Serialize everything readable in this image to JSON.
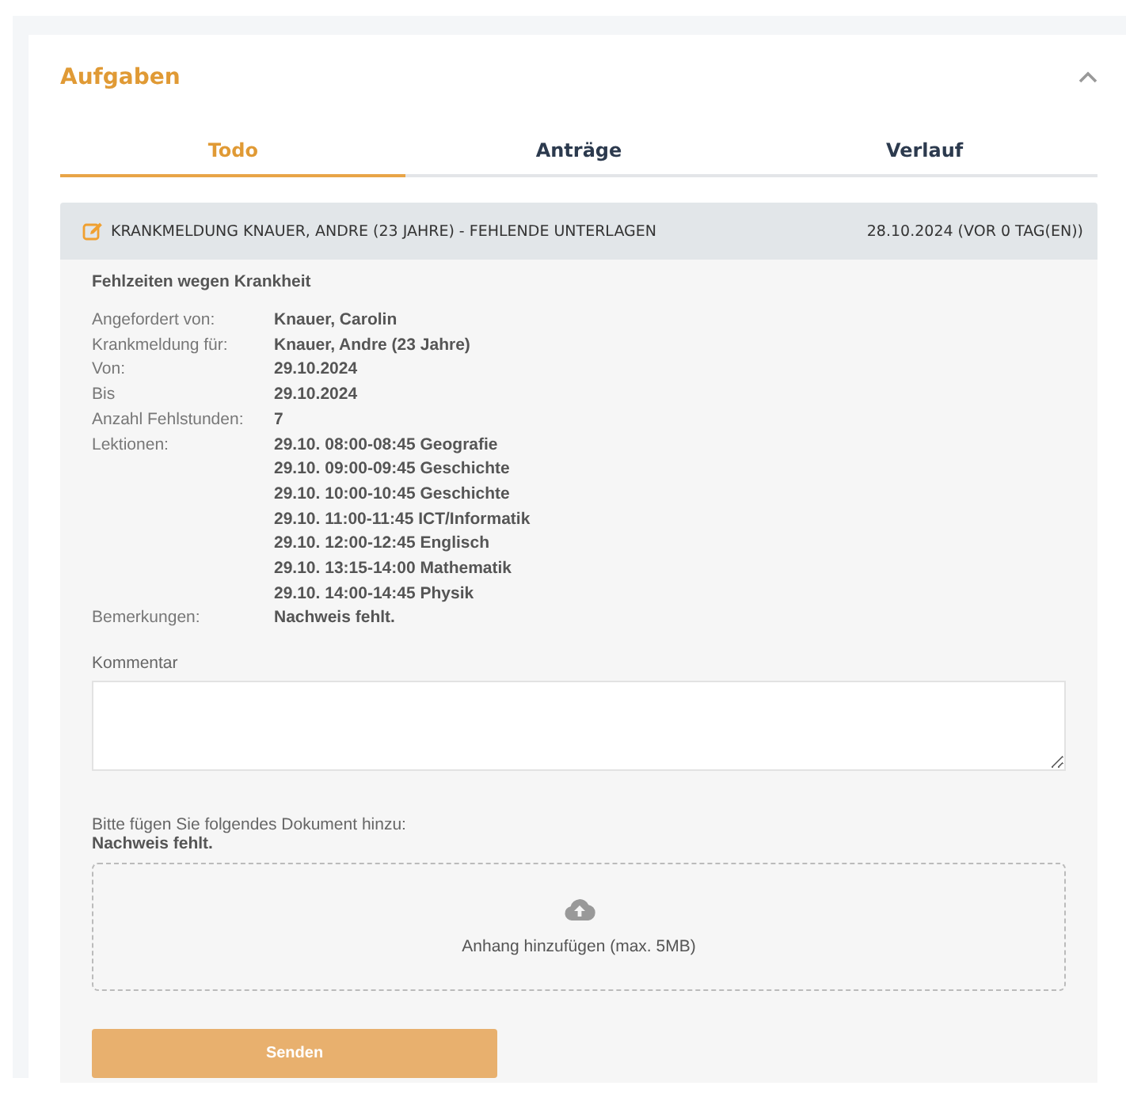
{
  "panel": {
    "title": "Aufgaben",
    "expanded": true
  },
  "tabs": [
    {
      "label": "Todo",
      "selected": true
    },
    {
      "label": "Anträge",
      "selected": false
    },
    {
      "label": "Verlauf",
      "selected": false
    }
  ],
  "task": {
    "title": "KRANKMELDUNG KNAUER, ANDRE (23 JAHRE) - FEHLENDE UNTERLAGEN",
    "date": "28.10.2024 (VOR 0 TAG(EN))",
    "section_title": "Fehlzeiten wegen Krankheit",
    "details": [
      {
        "label": "Angefordert von:",
        "values": [
          "Knauer, Carolin"
        ]
      },
      {
        "label": "Krankmeldung für:",
        "values": [
          "Knauer, Andre (23 Jahre)"
        ]
      },
      {
        "label": "Von:",
        "values": [
          "29.10.2024"
        ]
      },
      {
        "label": "Bis",
        "values": [
          "29.10.2024"
        ]
      },
      {
        "label": "Anzahl Fehlstunden:",
        "values": [
          "7"
        ]
      },
      {
        "label": "Lektionen:",
        "values": [
          "29.10. 08:00-08:45 Geografie",
          "29.10. 09:00-09:45 Geschichte",
          "29.10. 10:00-10:45 Geschichte",
          "29.10. 11:00-11:45 ICT/Informatik",
          "29.10. 12:00-12:45 Englisch",
          "29.10. 13:15-14:00 Mathematik",
          "29.10. 14:00-14:45 Physik"
        ]
      },
      {
        "label": "Bemerkungen:",
        "values": [
          "Nachweis fehlt."
        ]
      }
    ],
    "comment": {
      "label": "Kommentar"
    },
    "upload": {
      "instruction": "Bitte fügen Sie folgendes Dokument hinzu:",
      "document": "Nachweis fehlt.",
      "dropzone_text": "Anhang hinzufügen (max. 5MB)"
    },
    "submit_button": "Senden"
  }
}
